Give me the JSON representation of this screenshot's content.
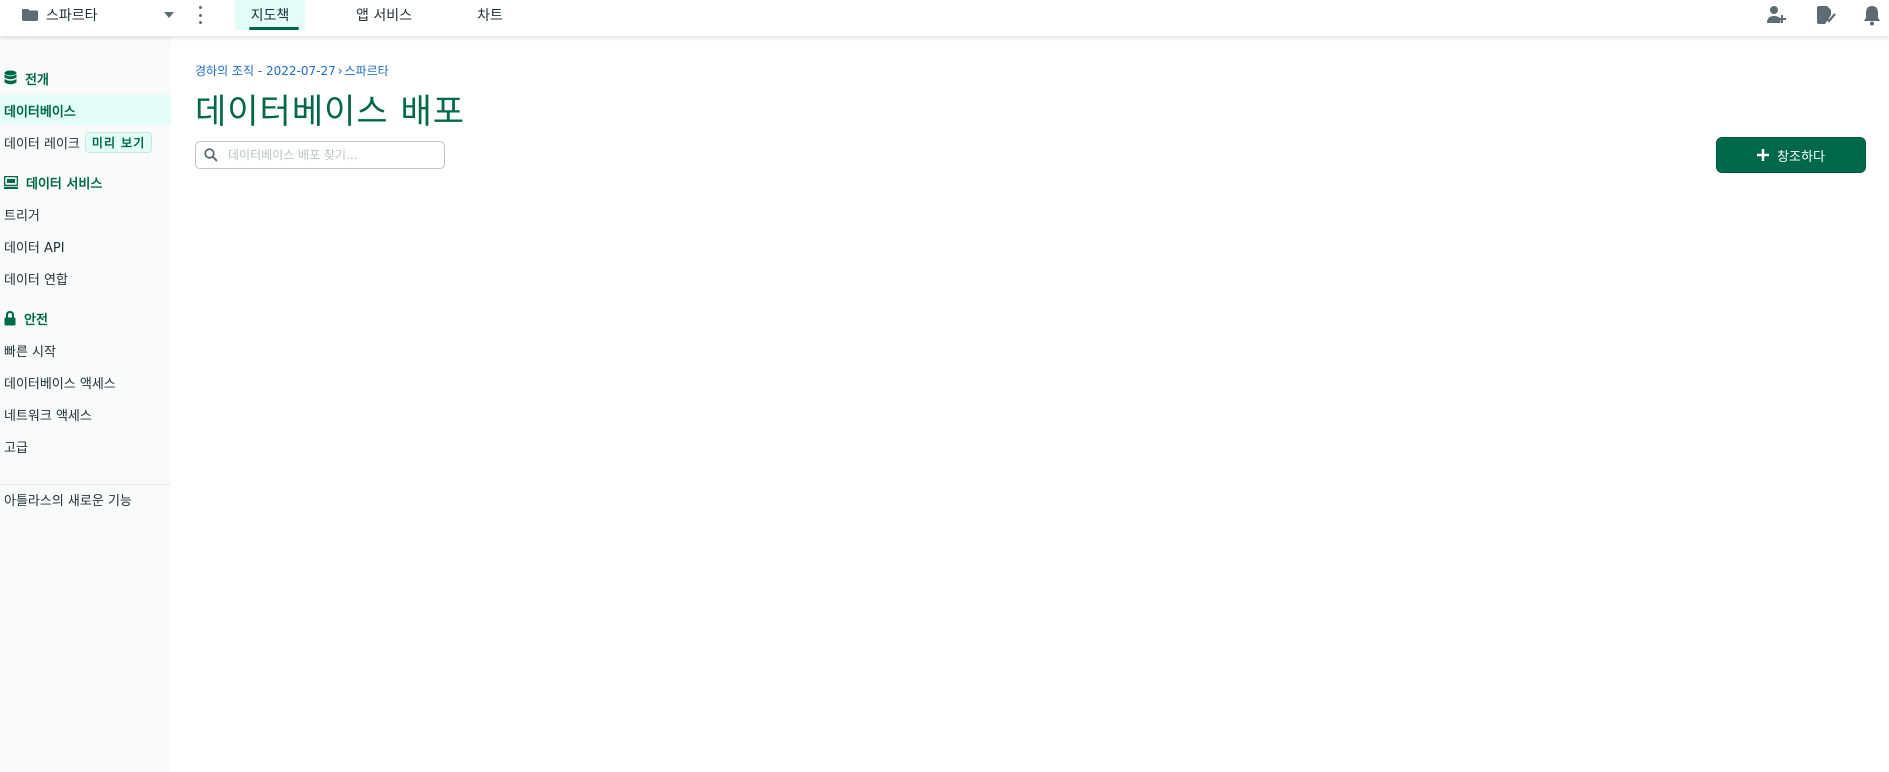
{
  "topbar": {
    "project_name": "스파르타",
    "tabs": [
      {
        "label": "지도책",
        "active": true
      },
      {
        "label": "앱 서비스",
        "active": false
      },
      {
        "label": "차트",
        "active": false
      }
    ],
    "icons": [
      "invite-user-icon",
      "activity-feed-icon",
      "notification-bell-icon"
    ]
  },
  "sidebar": {
    "sections": [
      {
        "heading": "전개",
        "icon": "database-icon"
      },
      {
        "heading": "데이터 서비스",
        "icon": "monitor-icon"
      },
      {
        "heading": "안전",
        "icon": "lock-icon"
      }
    ],
    "items": [
      {
        "label": "데이터베이스",
        "active": true
      },
      {
        "label": "데이터 레이크",
        "badge": "미리 보기"
      },
      {
        "label": "트리거"
      },
      {
        "label": "데이터 API"
      },
      {
        "label": "데이터 연합"
      },
      {
        "label": "빠른 시작"
      },
      {
        "label": "데이터베이스 액세스"
      },
      {
        "label": "네트워크 액세스"
      },
      {
        "label": "고급"
      },
      {
        "label": "아틀라스의 새로운 기능"
      }
    ]
  },
  "main": {
    "breadcrumb": {
      "org": "경하의 조직 - 2022-07-27",
      "separator": "›",
      "project": "스파르타"
    },
    "title": "데이터베이스 배포",
    "search_placeholder": "데이터베이스 배포 찾기...",
    "create_label": "창조하다"
  },
  "colors": {
    "brand_green": "#00684a",
    "active_bg": "#e3fcf7",
    "link_blue": "#1a6ac9"
  }
}
